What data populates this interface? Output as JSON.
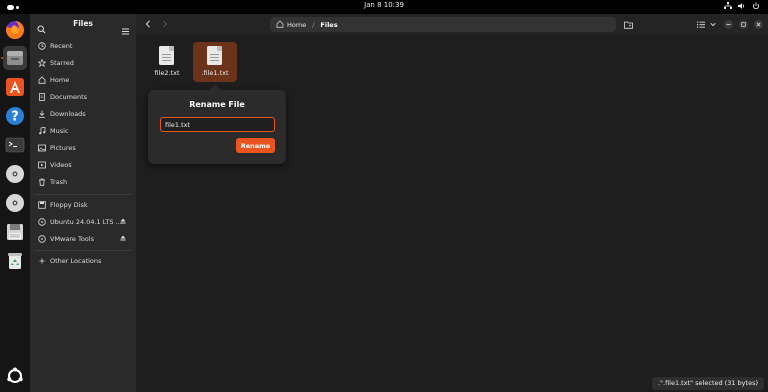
{
  "topbar": {
    "datetime": "Jan 8  10:39"
  },
  "dock": {
    "items": [
      {
        "name": "firefox-icon"
      },
      {
        "name": "files-icon"
      },
      {
        "name": "app-center-icon"
      },
      {
        "name": "help-icon"
      },
      {
        "name": "terminal-icon"
      },
      {
        "name": "disc-icon"
      },
      {
        "name": "disc-icon"
      },
      {
        "name": "floppy-icon"
      },
      {
        "name": "trash-icon"
      }
    ]
  },
  "sidebar": {
    "title": "Files",
    "items": [
      {
        "label": "Recent",
        "icon": "clock-icon"
      },
      {
        "label": "Starred",
        "icon": "star-icon"
      },
      {
        "label": "Home",
        "icon": "home-icon"
      },
      {
        "label": "Documents",
        "icon": "document-icon"
      },
      {
        "label": "Downloads",
        "icon": "download-icon"
      },
      {
        "label": "Music",
        "icon": "music-icon"
      },
      {
        "label": "Pictures",
        "icon": "picture-icon"
      },
      {
        "label": "Videos",
        "icon": "video-icon"
      },
      {
        "label": "Trash",
        "icon": "trash-icon"
      }
    ],
    "devices": [
      {
        "label": "Floppy Disk",
        "icon": "floppy-icon"
      },
      {
        "label": "Ubuntu 24.04.1 LTS ...",
        "icon": "disc-icon"
      },
      {
        "label": "VMware Tools",
        "icon": "disc-icon"
      }
    ],
    "other": {
      "label": "Other Locations",
      "icon": "plus-icon"
    }
  },
  "pathbar": {
    "home": "Home",
    "current": "Files"
  },
  "files": [
    {
      "name": "file2.txt",
      "selected": false
    },
    {
      "name": ".file1.txt",
      "selected": true
    }
  ],
  "rename": {
    "title": "Rename File",
    "value": "file1.txt",
    "button": "Rename"
  },
  "status": ".\".file1.txt\" selected  (31 bytes)",
  "colors": {
    "accent": "#e95420",
    "selected": "#6b3319"
  }
}
